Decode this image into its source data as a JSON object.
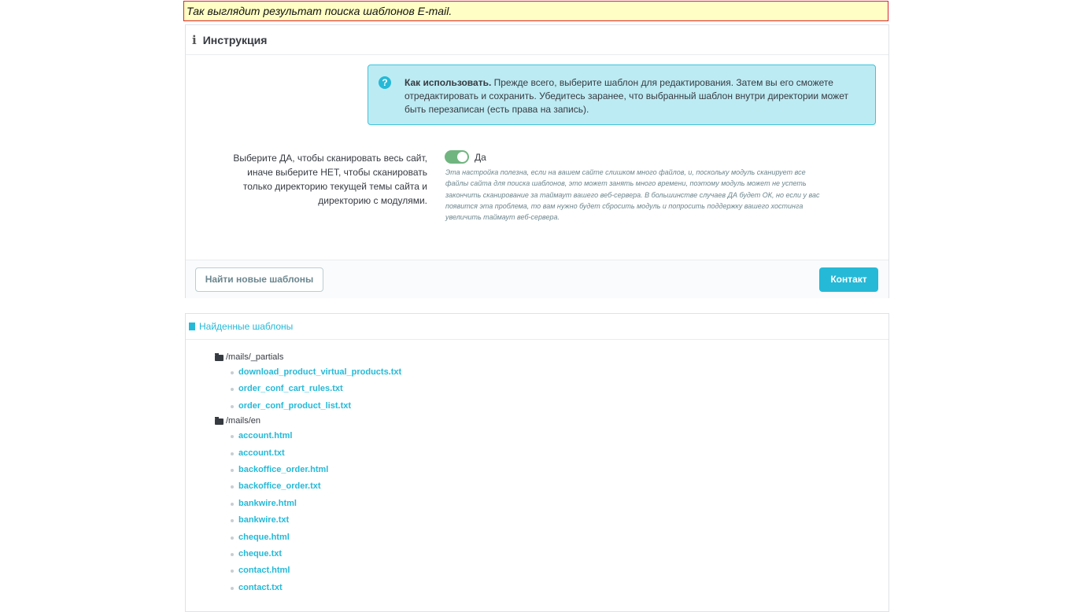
{
  "caption": "Так выглядит результат поиска шаблонов E-mail.",
  "instructions_panel": {
    "title": "Инструкция",
    "alert_bold": "Как использовать.",
    "alert_text": " Прежде всего, выберите шаблон для редактирования. Затем вы его сможете отредактировать и сохранить. Убедитесь заранее, что выбранный шаблон внутри директории может быть перезаписан (есть права на запись).",
    "scan_label": "Выберите ДА, чтобы сканировать весь сайт, иначе выберите НЕТ, чтобы сканировать только директорию текущей темы сайта и директорию с модулями.",
    "toggle_value": "Да",
    "help_text": "Эта настройка полезна, если на вашем сайте слишком много файлов, и, поскольку модуль сканирует все файлы сайта для поиска шаблонов, это может занять много времени, поэтому модуль может не успеть закончить сканирование за таймаут вашего веб-сервера. В большинстве случаев ДА будет ОК, но если у вас появится эта проблема, то вам нужно будет сбросить модуль и попросить поддержку вашего хостинга увеличить таймаут веб-сервера.",
    "find_button": "Найти новые шаблоны",
    "contact_button": "Контакт"
  },
  "found_panel": {
    "title": "Найденные шаблоны",
    "folders": [
      {
        "path": "/mails/_partials",
        "files": [
          "download_product_virtual_products.txt",
          "order_conf_cart_rules.txt",
          "order_conf_product_list.txt"
        ]
      },
      {
        "path": "/mails/en",
        "files": [
          "account.html",
          "account.txt",
          "backoffice_order.html",
          "backoffice_order.txt",
          "bankwire.html",
          "bankwire.txt",
          "cheque.html",
          "cheque.txt",
          "contact.html",
          "contact.txt"
        ]
      }
    ]
  }
}
